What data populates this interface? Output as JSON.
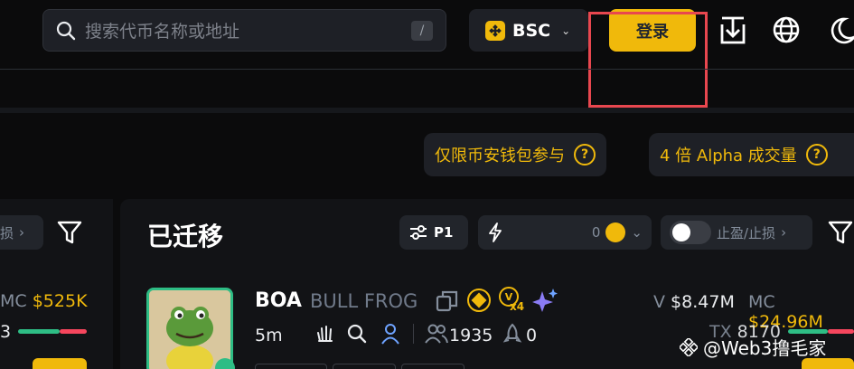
{
  "search": {
    "placeholder": "搜索代币名称或地址",
    "shortcut": "/"
  },
  "network": {
    "label": "BSC"
  },
  "header": {
    "login_label": "登录"
  },
  "promos": [
    {
      "label": "仅限币安钱包参与"
    },
    {
      "label": "4 倍 Alpha 成交量"
    }
  ],
  "left_column": {
    "filter_label": "损",
    "mc_label": "MC",
    "mc_value": "$525K",
    "tx_value": "3"
  },
  "section": {
    "title": "已迁移",
    "preset_label": "P1",
    "quickbuy_amount": "0",
    "tp_sl_label": "止盈/止损"
  },
  "token": {
    "symbol": "BOA",
    "name": "BULL FROG",
    "age": "5m",
    "holders": "1935",
    "snipers": "0",
    "volume_label": "V",
    "volume_value": "$8.47M",
    "mc_label": "MC",
    "mc_value": "$24.96M",
    "tx_label": "TX",
    "tx_value": "8170",
    "boost_multiplier": "x4"
  },
  "watermark": {
    "text": "@Web3撸毛家"
  },
  "colors": {
    "accent": "#f0b90b",
    "positive": "#2ebd85",
    "negative": "#f6465d"
  }
}
